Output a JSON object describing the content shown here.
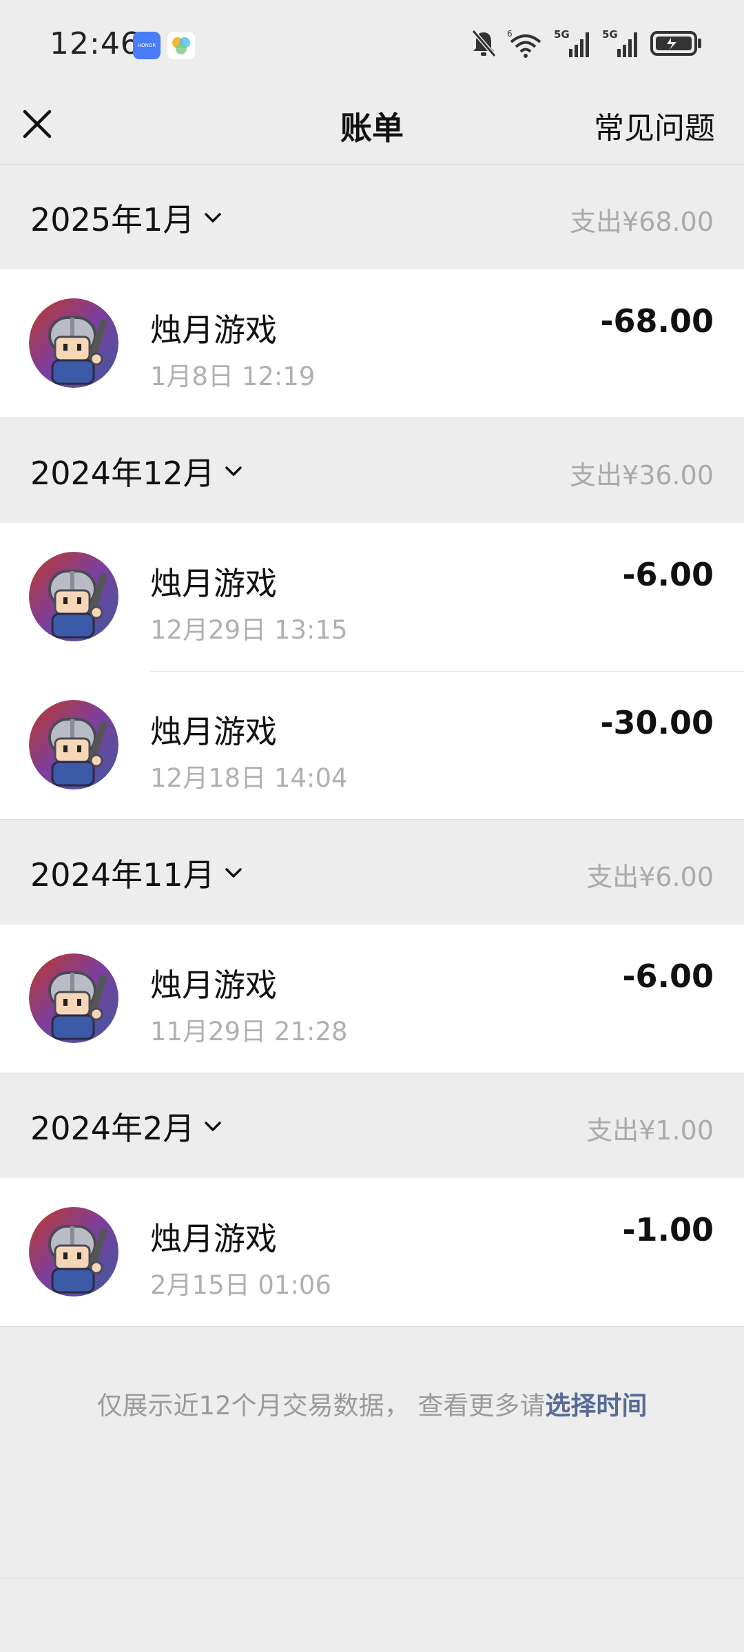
{
  "status": {
    "time": "12:46",
    "honor_badge": "HONOR",
    "icons": [
      "bell-off-icon",
      "wifi-icon",
      "signal-5g-icon",
      "signal-5g-icon",
      "battery-charging-icon"
    ]
  },
  "nav": {
    "title": "账单",
    "faq": "常见问题"
  },
  "months": [
    {
      "label": "2025年1月",
      "spend": "支出¥68.00",
      "transactions": [
        {
          "name": "烛月游戏",
          "time": "1月8日 12:19",
          "amount": "-68.00"
        }
      ]
    },
    {
      "label": "2024年12月",
      "spend": "支出¥36.00",
      "transactions": [
        {
          "name": "烛月游戏",
          "time": "12月29日 13:15",
          "amount": "-6.00"
        },
        {
          "name": "烛月游戏",
          "time": "12月18日 14:04",
          "amount": "-30.00"
        }
      ]
    },
    {
      "label": "2024年11月",
      "spend": "支出¥6.00",
      "transactions": [
        {
          "name": "烛月游戏",
          "time": "11月29日 21:28",
          "amount": "-6.00"
        }
      ]
    },
    {
      "label": "2024年2月",
      "spend": "支出¥1.00",
      "transactions": [
        {
          "name": "烛月游戏",
          "time": "2月15日 01:06",
          "amount": "-1.00"
        }
      ]
    }
  ],
  "footer": {
    "note": "仅展示近12个月交易数据， 查看更多请",
    "link": "选择时间"
  },
  "colors": {
    "background": "#ededed",
    "link": "#576b95",
    "muted": "#aaaaaa"
  }
}
